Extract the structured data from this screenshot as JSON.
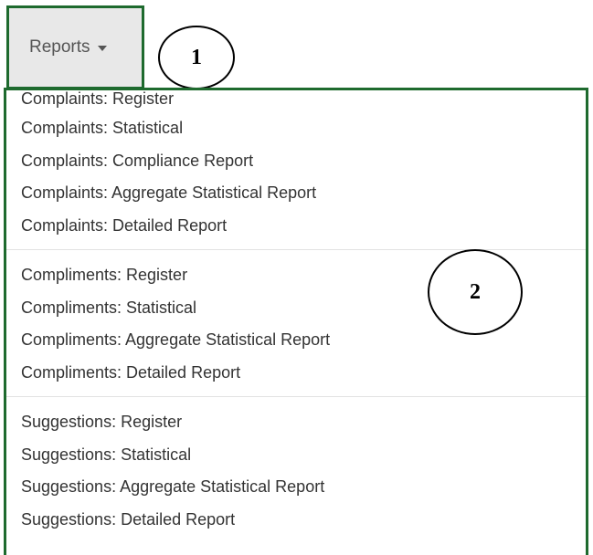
{
  "reports_button": {
    "label": "Reports"
  },
  "callouts": [
    {
      "label": "1"
    },
    {
      "label": "2"
    }
  ],
  "menu": {
    "groups": [
      {
        "items": [
          {
            "label": "Complaints: Register"
          },
          {
            "label": "Complaints: Statistical"
          },
          {
            "label": "Complaints: Compliance Report"
          },
          {
            "label": "Complaints: Aggregate Statistical Report"
          },
          {
            "label": "Complaints: Detailed Report"
          }
        ]
      },
      {
        "items": [
          {
            "label": "Compliments: Register"
          },
          {
            "label": "Compliments: Statistical"
          },
          {
            "label": "Compliments: Aggregate Statistical Report"
          },
          {
            "label": "Compliments: Detailed Report"
          }
        ]
      },
      {
        "items": [
          {
            "label": "Suggestions: Register"
          },
          {
            "label": "Suggestions: Statistical"
          },
          {
            "label": "Suggestions: Aggregate Statistical Report"
          },
          {
            "label": "Suggestions: Detailed Report"
          }
        ]
      }
    ]
  },
  "colors": {
    "highlight_border": "#1e6a2e",
    "button_background": "#e8e8e8",
    "menu_text": "#333333",
    "divider": "#e2e2e2"
  }
}
